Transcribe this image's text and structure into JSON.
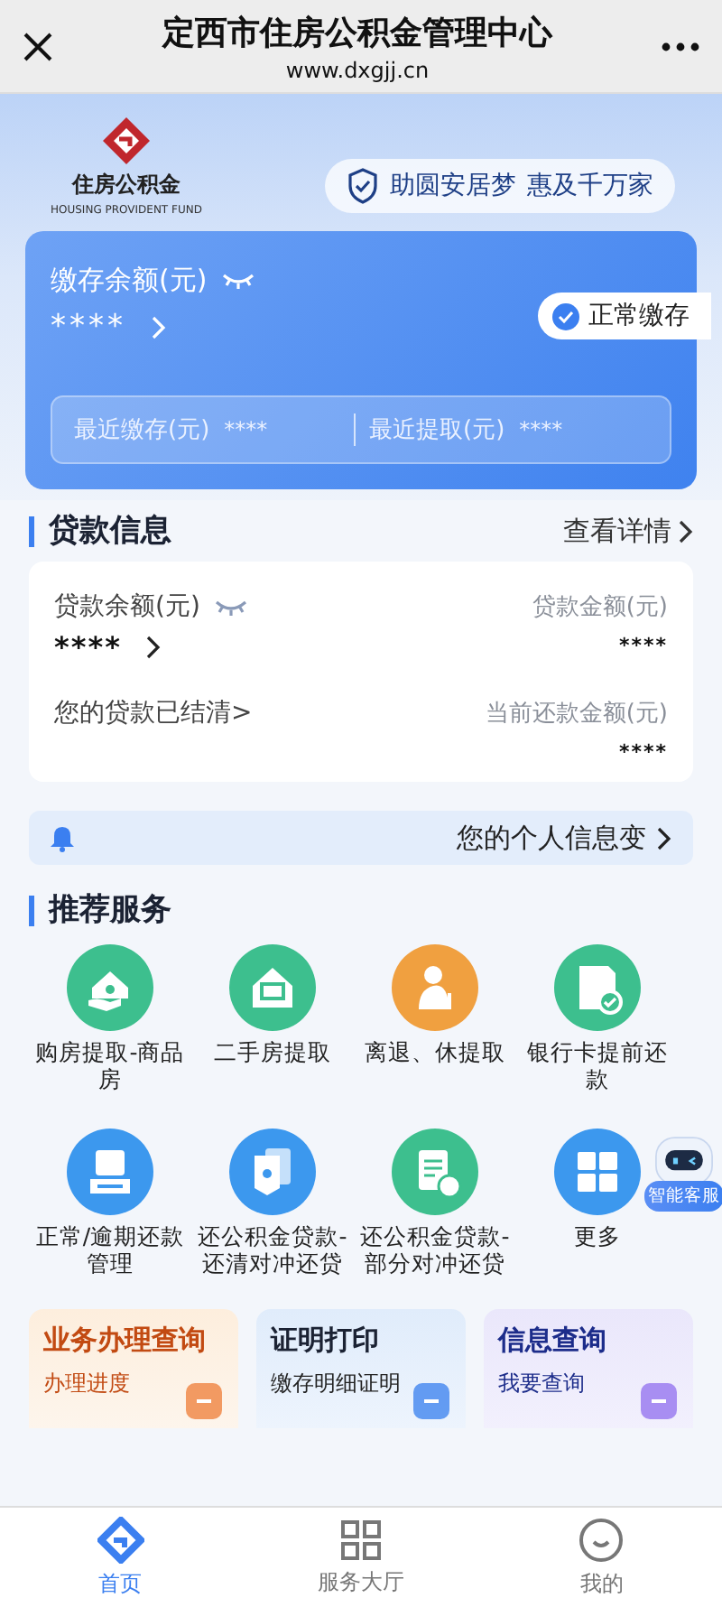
{
  "header": {
    "title": "定西市住房公积金管理中心",
    "url": "www.dxgjj.cn"
  },
  "brand": {
    "name": "住房公积金",
    "subtitle": "HOUSING PROVIDENT FUND"
  },
  "slogan": [
    "助圆安居梦",
    "惠及千万家"
  ],
  "deposit": {
    "label": "缴存余额(元)",
    "value": "****",
    "status": "正常缴存",
    "recent": [
      {
        "label": "最近缴存(元)",
        "value": "****"
      },
      {
        "label": "最近提取(元)",
        "value": "****"
      }
    ]
  },
  "loan": {
    "title": "贷款信息",
    "link": "查看详情",
    "balance_label": "贷款余额(元)",
    "balance_value": "****",
    "status_text": "您的贷款已结清>",
    "amounts": [
      {
        "label": "贷款金额(元)",
        "value": "****"
      },
      {
        "label": "当前还款金额(元)",
        "value": "****"
      }
    ]
  },
  "notice": {
    "text": "您的个人信息变"
  },
  "services": {
    "title": "推荐服务",
    "items": [
      {
        "label": "购房提取-商品房",
        "kind": "house-money",
        "color": "#3dbf8e"
      },
      {
        "label": "二手房提取",
        "kind": "house-cycle",
        "color": "#3dbf8e"
      },
      {
        "label": "离退、休提取",
        "kind": "elder",
        "color": "#f0a040"
      },
      {
        "label": "银行卡提前还款",
        "kind": "loan-check",
        "color": "#3dbf8e"
      },
      {
        "label": "正常/逾期还款管理",
        "kind": "terminal",
        "color": "#3c98ee"
      },
      {
        "label": "还公积金贷款-还清对冲还贷",
        "kind": "cards",
        "color": "#3c98ee"
      },
      {
        "label": "还公积金贷款-部分对冲还贷",
        "kind": "doc-cycle",
        "color": "#3dbf8e"
      },
      {
        "label": "更多",
        "kind": "grid",
        "color": "#3c98ee"
      }
    ]
  },
  "assistant": {
    "label": "智能客服"
  },
  "quick_cards": [
    {
      "title": "业务办理查询",
      "subtitle": "办理进度",
      "kind": "orange"
    },
    {
      "title": "证明打印",
      "subtitle": "缴存明细证明",
      "kind": "blue"
    },
    {
      "title": "信息查询",
      "subtitle": "我要查询",
      "kind": "purple"
    }
  ],
  "tabs": [
    {
      "label": "首页",
      "kind": "home",
      "selected": true
    },
    {
      "label": "服务大厅",
      "kind": "hall",
      "selected": false
    },
    {
      "label": "我的",
      "kind": "me",
      "selected": false
    }
  ]
}
